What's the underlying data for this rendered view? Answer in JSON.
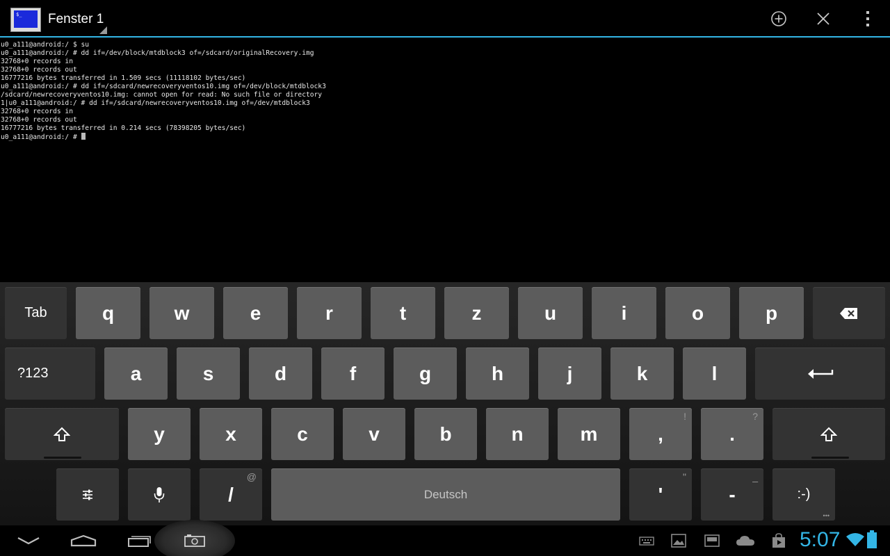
{
  "actionbar": {
    "title": "Fenster 1",
    "icons": [
      "app-icon",
      "add-window-icon",
      "close-window-icon",
      "overflow-menu-icon"
    ]
  },
  "terminal": {
    "lines": [
      "u0_a111@android:/ $ su",
      "u0_a111@android:/ # dd if=/dev/block/mtdblock3 of=/sdcard/originalRecovery.img",
      "32768+0 records in",
      "32768+0 records out",
      "16777216 bytes transferred in 1.509 secs (11118102 bytes/sec)",
      "u0_a111@android:/ # dd if=/sdcard/newrecoveryventos10.img of=/dev/block/mtdblock3",
      "/sdcard/newrecoveryventos10.img: cannot open for read: No such file or directory",
      "1|u0_a111@android:/ # dd if=/sdcard/newrecoveryventos10.img of=/dev/mtdblock3",
      "32768+0 records in",
      "32768+0 records out",
      "16777216 bytes transferred in 0.214 secs (78398205 bytes/sec)",
      "u0_a111@android:/ # "
    ]
  },
  "keyboard": {
    "row1": {
      "tab": "Tab",
      "letters": [
        "q",
        "w",
        "e",
        "r",
        "t",
        "z",
        "u",
        "i",
        "o",
        "p"
      ]
    },
    "row2": {
      "symbols": "?123",
      "letters": [
        "a",
        "s",
        "d",
        "f",
        "g",
        "h",
        "j",
        "k",
        "l"
      ]
    },
    "row3": {
      "letters": [
        "y",
        "x",
        "c",
        "v",
        "b",
        "n",
        "m"
      ],
      "comma": ",",
      "comma_hint": "!",
      "period": ".",
      "period_hint": "?"
    },
    "row4": {
      "slash": "/",
      "slash_hint": "@",
      "space": "Deutsch",
      "apostrophe": "'",
      "apostrophe_hint": "\"",
      "dash": "-",
      "dash_hint": "_",
      "smiley": ":-)"
    },
    "colors": {
      "light_key": "#5c5c5c",
      "dark_key": "#333333"
    }
  },
  "navbar": {
    "clock": "5:07",
    "accent": "#33b5e5",
    "icons": [
      "back-icon",
      "home-icon",
      "recent-apps-icon",
      "screenshot-icon",
      "keyboard-notification-icon",
      "gallery-notification-icon",
      "screen-notification-icon",
      "cloud-notification-icon",
      "store-notification-icon",
      "wifi-icon",
      "battery-icon"
    ]
  }
}
